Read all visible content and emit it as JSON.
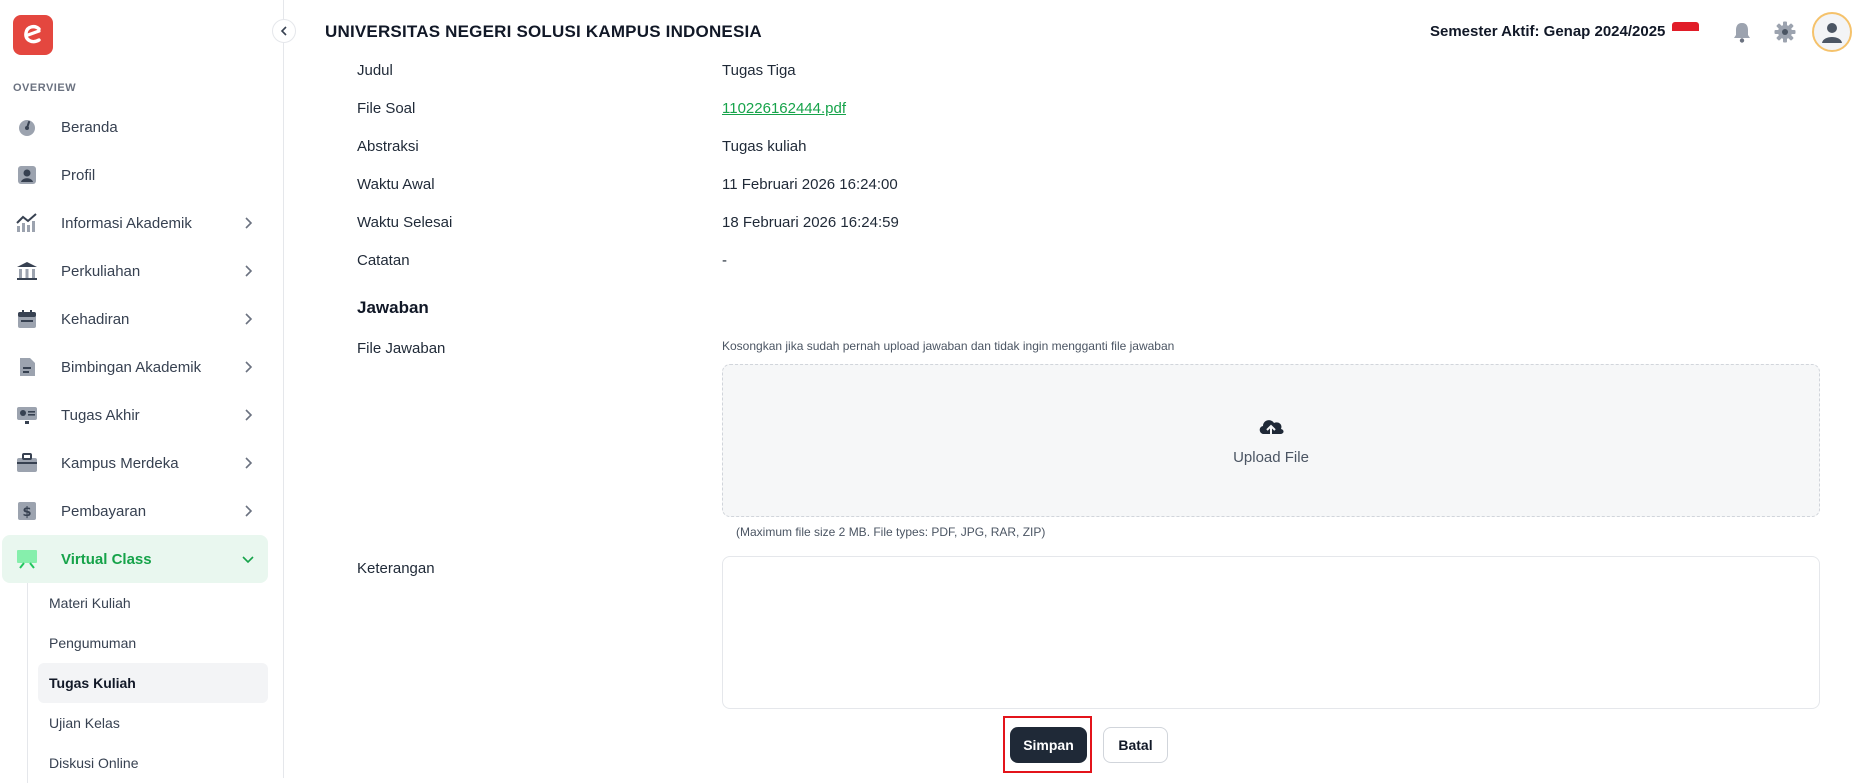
{
  "app": {
    "university": "UNIVERSITAS NEGERI SOLUSI KAMPUS INDONESIA",
    "semester": "Semester Aktif: Genap 2024/2025",
    "brand_color": "#e4473f",
    "accent_color": "#16a34a"
  },
  "sidebar": {
    "section": "OVERVIEW",
    "items": [
      {
        "label": "Beranda",
        "icon": "dashboard-gauge-icon"
      },
      {
        "label": "Profil",
        "icon": "user-icon"
      },
      {
        "label": "Informasi Akademik",
        "icon": "chart-trend-icon"
      },
      {
        "label": "Perkuliahan",
        "icon": "building-columns-icon"
      },
      {
        "label": "Kehadiran",
        "icon": "calendar-icon"
      },
      {
        "label": "Bimbingan Akademik",
        "icon": "document-icon"
      },
      {
        "label": "Tugas Akhir",
        "icon": "id-card-icon"
      },
      {
        "label": "Kampus Merdeka",
        "icon": "briefcase-icon"
      },
      {
        "label": "Pembayaran",
        "icon": "dollar-icon"
      },
      {
        "label": "Virtual Class",
        "icon": "presentation-board-icon"
      }
    ],
    "subitems": [
      "Materi Kuliah",
      "Pengumuman",
      "Tugas Kuliah",
      "Ujian Kelas",
      "Diskusi Online"
    ]
  },
  "detail": {
    "judul_label": "Judul",
    "judul_value": "Tugas Tiga",
    "file_soal_label": "File Soal",
    "file_soal_value": "110226162444.pdf",
    "abstraksi_label": "Abstraksi",
    "abstraksi_value": "Tugas kuliah",
    "waktu_awal_label": "Waktu Awal",
    "waktu_awal_value": "11 Februari 2026 16:24:00",
    "waktu_selesai_label": "Waktu Selesai",
    "waktu_selesai_value": "18 Februari 2026 16:24:59",
    "catatan_label": "Catatan",
    "catatan_value": "-"
  },
  "jawaban": {
    "title": "Jawaban",
    "file_label": "File Jawaban",
    "hint": "Kosongkan jika sudah pernah upload jawaban dan tidak ingin mengganti file jawaban",
    "upload_label": "Upload File",
    "upload_note": "(Maximum file size 2 MB. File types: PDF, JPG, RAR, ZIP)",
    "keterangan_label": "Keterangan",
    "keterangan_value": ""
  },
  "actions": {
    "save": "Simpan",
    "cancel": "Batal"
  }
}
